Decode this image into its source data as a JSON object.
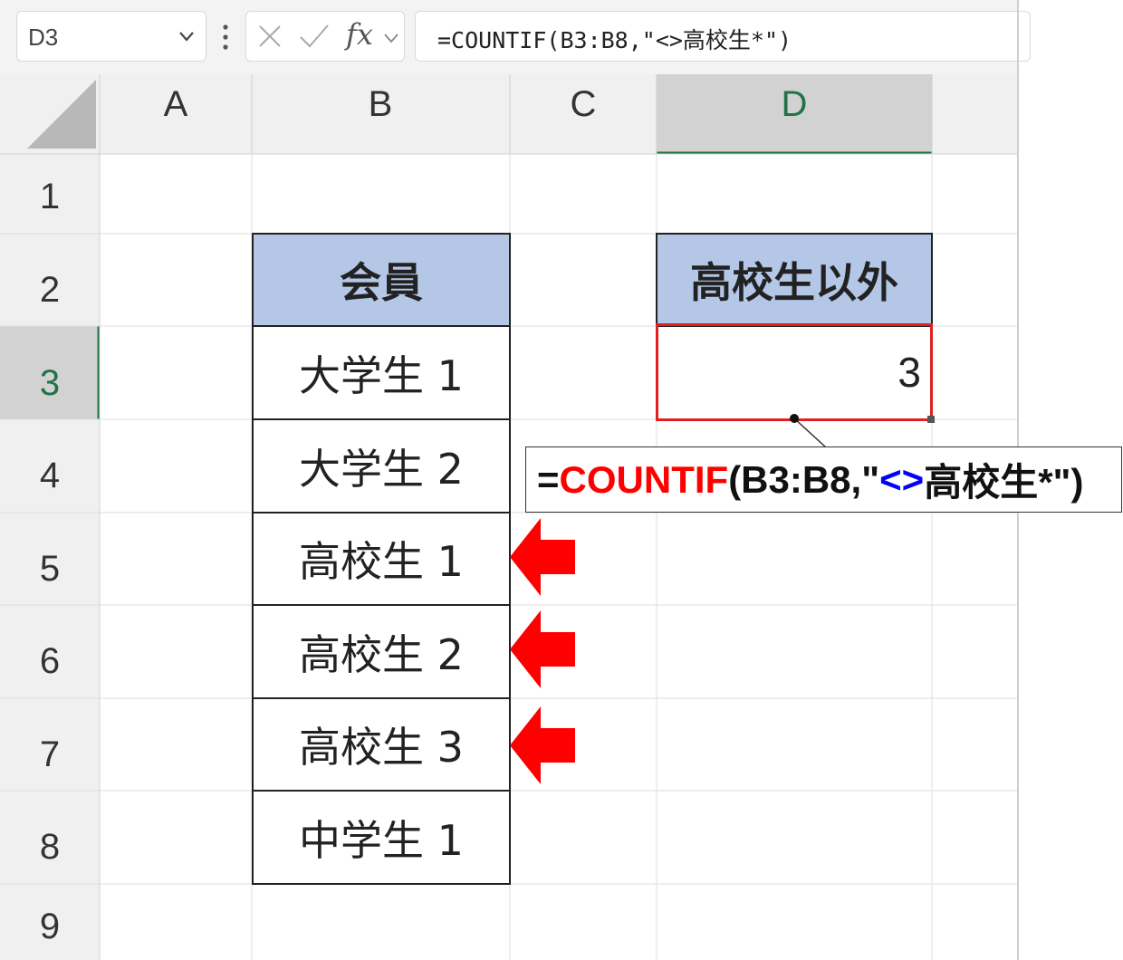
{
  "name_box": {
    "value": "D3"
  },
  "formula_bar": {
    "fx": "fx",
    "formula": "=COUNTIF(B3:B8,\"<>高校生*\")"
  },
  "columns": [
    "A",
    "B",
    "C",
    "D"
  ],
  "active_column": "D",
  "rows": [
    "1",
    "2",
    "3",
    "4",
    "5",
    "6",
    "7",
    "8",
    "9"
  ],
  "active_row": "3",
  "table_b": {
    "header": "会員",
    "items": [
      "大学生 1",
      "大学生 2",
      "高校生 1",
      "高校生 2",
      "高校生 3",
      "中学生 1"
    ]
  },
  "table_d": {
    "header": "高校生以外",
    "result": "3"
  },
  "callout": {
    "eq": "=",
    "func": "COUNTIF",
    "args_start": "(B3:B8,\"",
    "op": "<>",
    "args_end": "高校生*\")"
  },
  "colors": {
    "header_fill": "#b4c7e7",
    "highlight": "#e02020",
    "arrow": "#ff0000",
    "function": "#ff0000",
    "operator": "#0000ff",
    "active_header": "#217346"
  },
  "icons": [
    "chevron-down-icon",
    "more-vertical-icon",
    "cancel-icon",
    "enter-check-icon",
    "fx-icon",
    "left-arrow-icon"
  ]
}
